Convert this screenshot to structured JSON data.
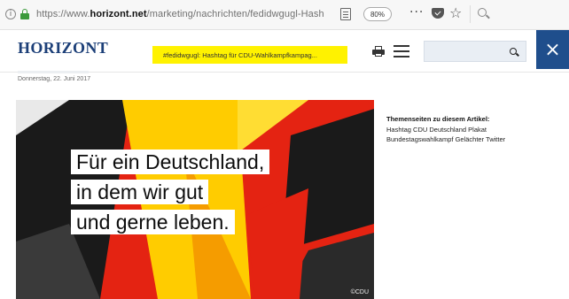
{
  "browser": {
    "url_prefix": "https://www.",
    "url_domain": "horizont.net",
    "url_path": "/marketing/nachrichten/fedidwgugl-Hash",
    "zoom": "80%",
    "more": "···"
  },
  "header": {
    "logo": "HORIZONT",
    "headline": "#fedidwgugl: Hashtag für CDU-Wahlkampfkampag...",
    "close_label": "×",
    "search_placeholder": ""
  },
  "article": {
    "date": "Donnerstag, 22. Juni 2017",
    "hero_lines": [
      "Für ein Deutschland,",
      "in dem wir gut",
      "und gerne leben."
    ],
    "hero_credit": "©CDU"
  },
  "topics": {
    "title": "Themenseiten zu diesem Artikel:",
    "links": [
      "Hashtag",
      "CDU",
      "Deutschland",
      "Plakat",
      "Bundestagswahlkampf",
      "Gelächter",
      "Twitter"
    ]
  },
  "colors": {
    "brand_blue": "#1c3f78",
    "close_blue": "#1f4e8c",
    "highlight_yellow": "#fff200",
    "flag_red": "#e42312",
    "flag_gold": "#ffcc00",
    "flag_black": "#1a1a1a"
  }
}
